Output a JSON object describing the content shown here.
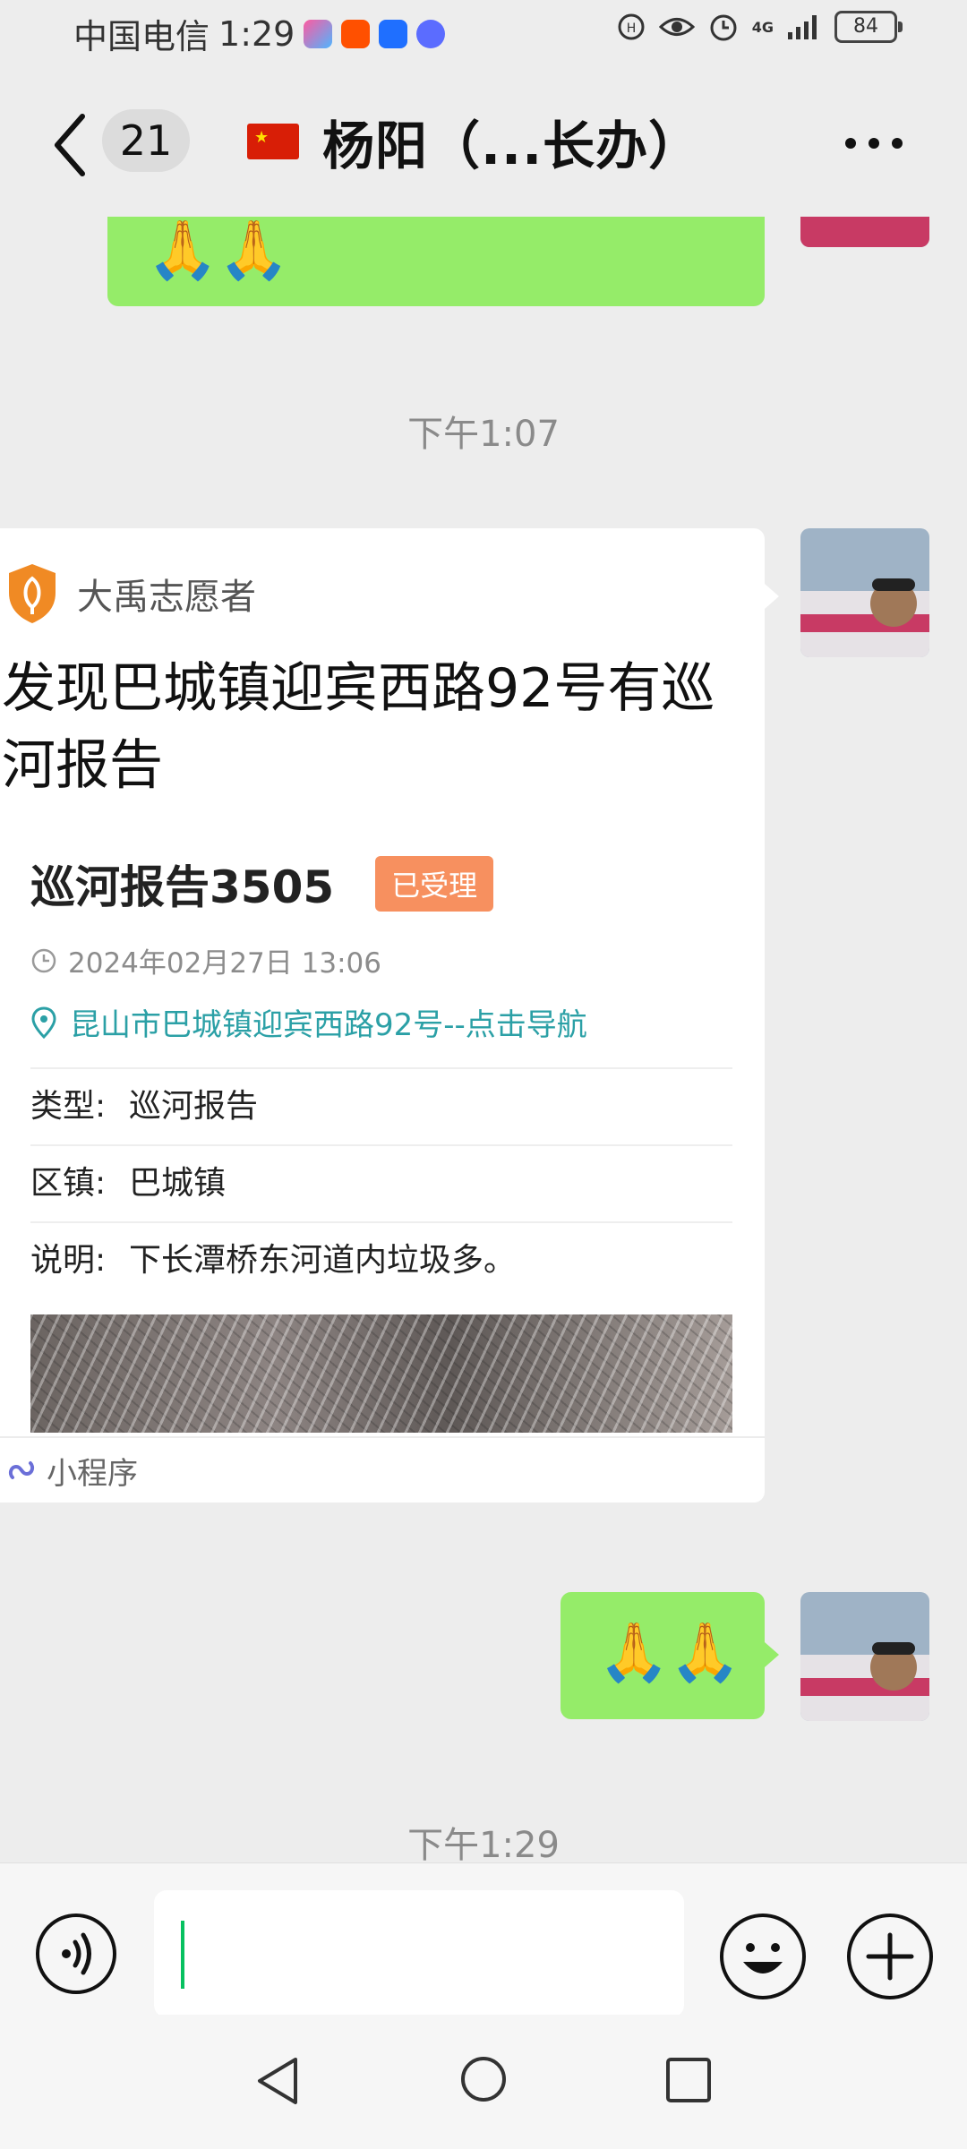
{
  "status_bar": {
    "carrier": "中国电信",
    "time": "1:29",
    "battery": "84",
    "network": "4G"
  },
  "header": {
    "unread_count": "21",
    "title": "杨阳（...长办）"
  },
  "messages": {
    "top_reply": "🙏🙏",
    "timestamp_1": "下午1:07",
    "card": {
      "source": "大禹志愿者",
      "title": "发现巴城镇迎宾西路92号有巡河报告",
      "report_title": "巡河报告3505",
      "status": "已受理",
      "datetime": "2024年02月27日 13:06",
      "location": "昆山市巴城镇迎宾西路92号--点击导航",
      "rows": [
        {
          "label": "类型:",
          "value": "巡河报告"
        },
        {
          "label": "区镇:",
          "value": "巴城镇"
        },
        {
          "label": "说明:",
          "value": "下长潭桥东河道内垃圾多。"
        }
      ],
      "footer": "小程序"
    },
    "reply": "🙏🙏",
    "timestamp_2": "下午1:29"
  },
  "input": {
    "value": ""
  },
  "colors": {
    "bubble_green": "#95ec69",
    "status_orange": "#f7905f",
    "link_teal": "#2ba0a6",
    "caret_green": "#07c160"
  }
}
